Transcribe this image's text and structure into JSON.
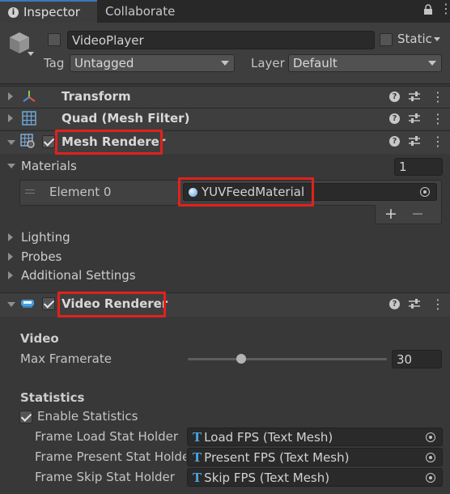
{
  "tabs": {
    "inspector": "Inspector",
    "collaborate": "Collaborate"
  },
  "header": {
    "object_name": "VideoPlayer",
    "static_label": "Static",
    "tag_label": "Tag",
    "tag_value": "Untagged",
    "layer_label": "Layer",
    "layer_value": "Default"
  },
  "components": {
    "transform": "Transform",
    "quad": "Quad (Mesh Filter)",
    "mesh_renderer": "Mesh Renderer",
    "video_renderer": "Video Renderer"
  },
  "materials": {
    "label": "Materials",
    "count": "1",
    "element_label": "Element 0",
    "element_value": "YUVFeedMaterial",
    "add": "+",
    "remove": "−"
  },
  "mesh_sections": [
    "Lighting",
    "Probes",
    "Additional Settings"
  ],
  "video": {
    "section": "Video",
    "max_framerate_label": "Max Framerate",
    "max_framerate_value": "30",
    "max_framerate_fraction": 0.27
  },
  "statistics": {
    "section": "Statistics",
    "enable_label": "Enable Statistics",
    "rows": [
      {
        "label": "Frame Load Stat Holder",
        "value": "Load FPS (Text Mesh)"
      },
      {
        "label": "Frame Present Stat Holder",
        "value": "Present FPS (Text Mesh)"
      },
      {
        "label": "Frame Skip Stat Holder",
        "value": "Skip FPS (Text Mesh)"
      }
    ]
  },
  "colors": {
    "highlight": "#e0221d",
    "accent": "#3a79bb",
    "background": "#383838"
  }
}
